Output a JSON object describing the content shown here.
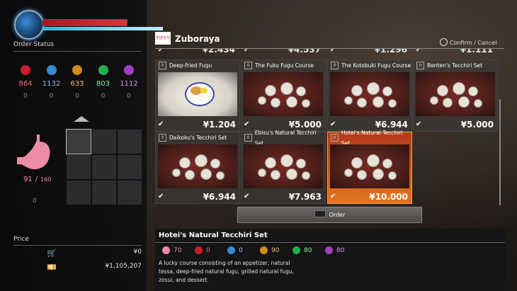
{
  "order_status_label": "Order Status",
  "price_label": "Price",
  "stats": [
    {
      "name": "strength",
      "icon": "fist-icon",
      "color": "#c8202a",
      "value": "864",
      "delta": "0",
      "text_color": "#f07070"
    },
    {
      "name": "agility",
      "icon": "swirl-icon",
      "color": "#3a8ad6",
      "value": "1132",
      "delta": "0",
      "text_color": "#8ac0f0"
    },
    {
      "name": "technique",
      "icon": "hand-icon",
      "color": "#d08a20",
      "value": "633",
      "delta": "0",
      "text_color": "#f0c070"
    },
    {
      "name": "heat",
      "icon": "flame-icon",
      "color": "#20b050",
      "value": "803",
      "delta": "0",
      "text_color": "#80f0a0"
    },
    {
      "name": "spirit",
      "icon": "star-icon",
      "color": "#a040c0",
      "value": "1112",
      "delta": "0",
      "text_color": "#e090f0"
    }
  ],
  "stomach": {
    "current": "91",
    "separator": "/",
    "max": "160",
    "delta": "0"
  },
  "price_rows": {
    "cart_value": "¥0",
    "wallet_value": "¥1,105,207"
  },
  "shop": {
    "logo_text": "ずぼらや",
    "name": "Zuboraya",
    "confirm_cancel": "Confirm / Cancel",
    "order_label": "Order"
  },
  "prev_row_prices": [
    "¥2.434",
    "¥4.537",
    "¥1.296",
    "¥1.111"
  ],
  "items": [
    {
      "num": "0",
      "title": "Deep-fried Fugu",
      "price": "¥1.204",
      "check": "✔",
      "img": "plate",
      "selected": false
    },
    {
      "num": "0",
      "title": "The Fuku Fugu Course",
      "price": "¥5.000",
      "check": "✔",
      "img": "table",
      "selected": false
    },
    {
      "num": "0",
      "title": "The Kotobuki Fugu Course",
      "price": "¥6.944",
      "check": "✔",
      "img": "table",
      "selected": false
    },
    {
      "num": "0",
      "title": "Benten's Tecchiri Set",
      "price": "¥5.000",
      "check": "✔",
      "img": "table",
      "selected": false
    },
    {
      "num": "0",
      "title": "Daikoku's Tecchiri Set",
      "price": "¥6.944",
      "check": "✔",
      "img": "table",
      "selected": false
    },
    {
      "num": "0",
      "title": "Ebisu's Natural Tecchiri Set",
      "price": "¥7.963",
      "check": "✔",
      "img": "table",
      "selected": false
    },
    {
      "num": "0",
      "title": "Hotei's Natural Tecchiri Set",
      "price": "¥10.000",
      "check": "✔",
      "img": "table",
      "selected": true
    }
  ],
  "selected_item": {
    "title": "Hotei's Natural Tecchiri Set",
    "stats": [
      {
        "icon": "stomach-icon",
        "color": "#f08aa6",
        "value": "70",
        "text_color": "#f08aa6"
      },
      {
        "icon": "fist-icon",
        "color": "#c8202a",
        "value": "0",
        "text_color": "#f07070"
      },
      {
        "icon": "swirl-icon",
        "color": "#3a8ad6",
        "value": "0",
        "text_color": "#8ac0f0"
      },
      {
        "icon": "hand-icon",
        "color": "#d08a20",
        "value": "90",
        "text_color": "#f0c070"
      },
      {
        "icon": "flame-icon",
        "color": "#20b050",
        "value": "80",
        "text_color": "#80f0a0"
      },
      {
        "icon": "star-icon",
        "color": "#a040c0",
        "value": "80",
        "text_color": "#e090f0"
      }
    ],
    "description": "A lucky course consisting of an appetizer, natural tessa, deep-fried natural fugu, grilled natural fugu, zosui, and dessert."
  },
  "hp_fraction": 1.0,
  "heat_fraction": 1.0
}
